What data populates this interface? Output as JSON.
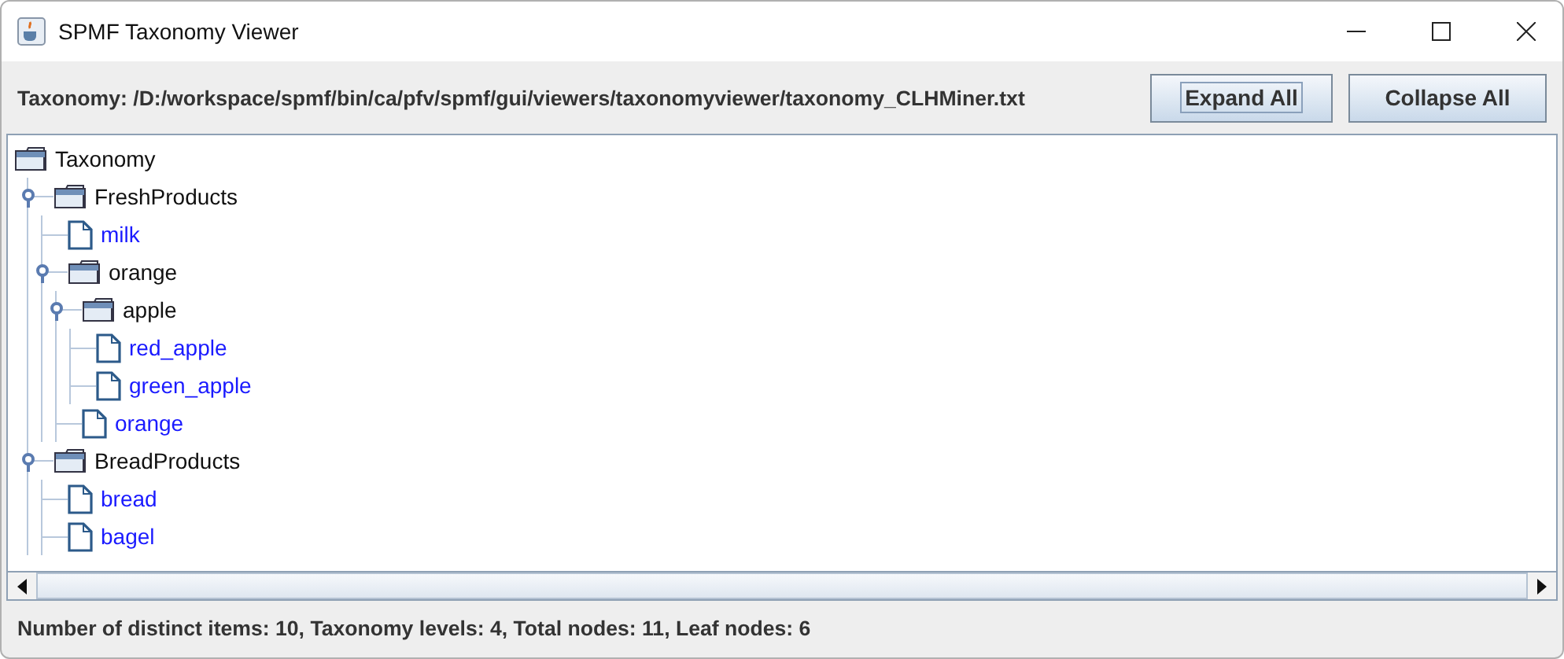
{
  "window": {
    "title": "SPMF Taxonomy Viewer"
  },
  "toolbar": {
    "path_label": "Taxonomy: /D:/workspace/spmf/bin/ca/pfv/spmf/gui/viewers/taxonomyviewer/taxonomy_CLHMiner.txt",
    "buttons": [
      {
        "label": "Expand All",
        "focused": true
      },
      {
        "label": "Collapse All",
        "focused": false
      }
    ]
  },
  "tree": {
    "root": {
      "label": "Taxonomy",
      "kind": "folder",
      "children": [
        {
          "label": "FreshProducts",
          "kind": "folder",
          "expanded": true,
          "children": [
            {
              "label": "milk",
              "kind": "leaf"
            },
            {
              "label": "orange",
              "kind": "folder",
              "expanded": true,
              "children": [
                {
                  "label": "apple",
                  "kind": "folder",
                  "expanded": true,
                  "children": [
                    {
                      "label": "red_apple",
                      "kind": "leaf"
                    },
                    {
                      "label": "green_apple",
                      "kind": "leaf"
                    }
                  ]
                },
                {
                  "label": "orange",
                  "kind": "leaf"
                }
              ]
            }
          ]
        },
        {
          "label": "BreadProducts",
          "kind": "folder",
          "expanded": true,
          "children": [
            {
              "label": "bread",
              "kind": "leaf"
            },
            {
              "label": "bagel",
              "kind": "leaf"
            }
          ]
        }
      ]
    }
  },
  "status_bar": "Number of distinct items: 10, Taxonomy levels: 4, Total nodes: 11, Leaf nodes: 6"
}
